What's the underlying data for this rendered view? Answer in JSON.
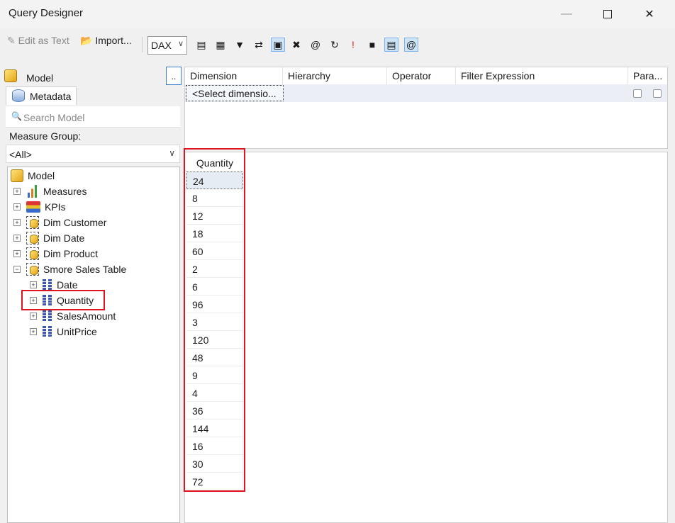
{
  "window": {
    "title": "Query Designer"
  },
  "toolbar": {
    "edit_as_text": "Edit as Text",
    "import": "Import...",
    "query_language": "DAX"
  },
  "left": {
    "model_label": "Model",
    "more_button": "..",
    "metadata_tab": "Metadata",
    "search_placeholder": "Search Model",
    "measure_group_label": "Measure Group:",
    "measure_group_value": "<All>",
    "tree": {
      "root": "Model",
      "measures": "Measures",
      "kpis": "KPIs",
      "dim_customer": "Dim Customer",
      "dim_date": "Dim Date",
      "dim_product": "Dim Product",
      "smore_sales_table": "Smore Sales Table",
      "date": "Date",
      "quantity": "Quantity",
      "sales_amount": "SalesAmount",
      "unit_price": "UnitPrice"
    }
  },
  "filter": {
    "headers": [
      "Dimension",
      "Hierarchy",
      "Operator",
      "Filter Expression",
      "Para..."
    ],
    "select_dimension": "<Select dimensio..."
  },
  "results": {
    "column": "Quantity",
    "values": [
      "24",
      "8",
      "12",
      "18",
      "60",
      "2",
      "6",
      "96",
      "3",
      "120",
      "48",
      "9",
      "4",
      "36",
      "144",
      "16",
      "30",
      "72"
    ]
  },
  "colors": {
    "highlight": "#e0141e",
    "accent": "#3c7fd1"
  }
}
